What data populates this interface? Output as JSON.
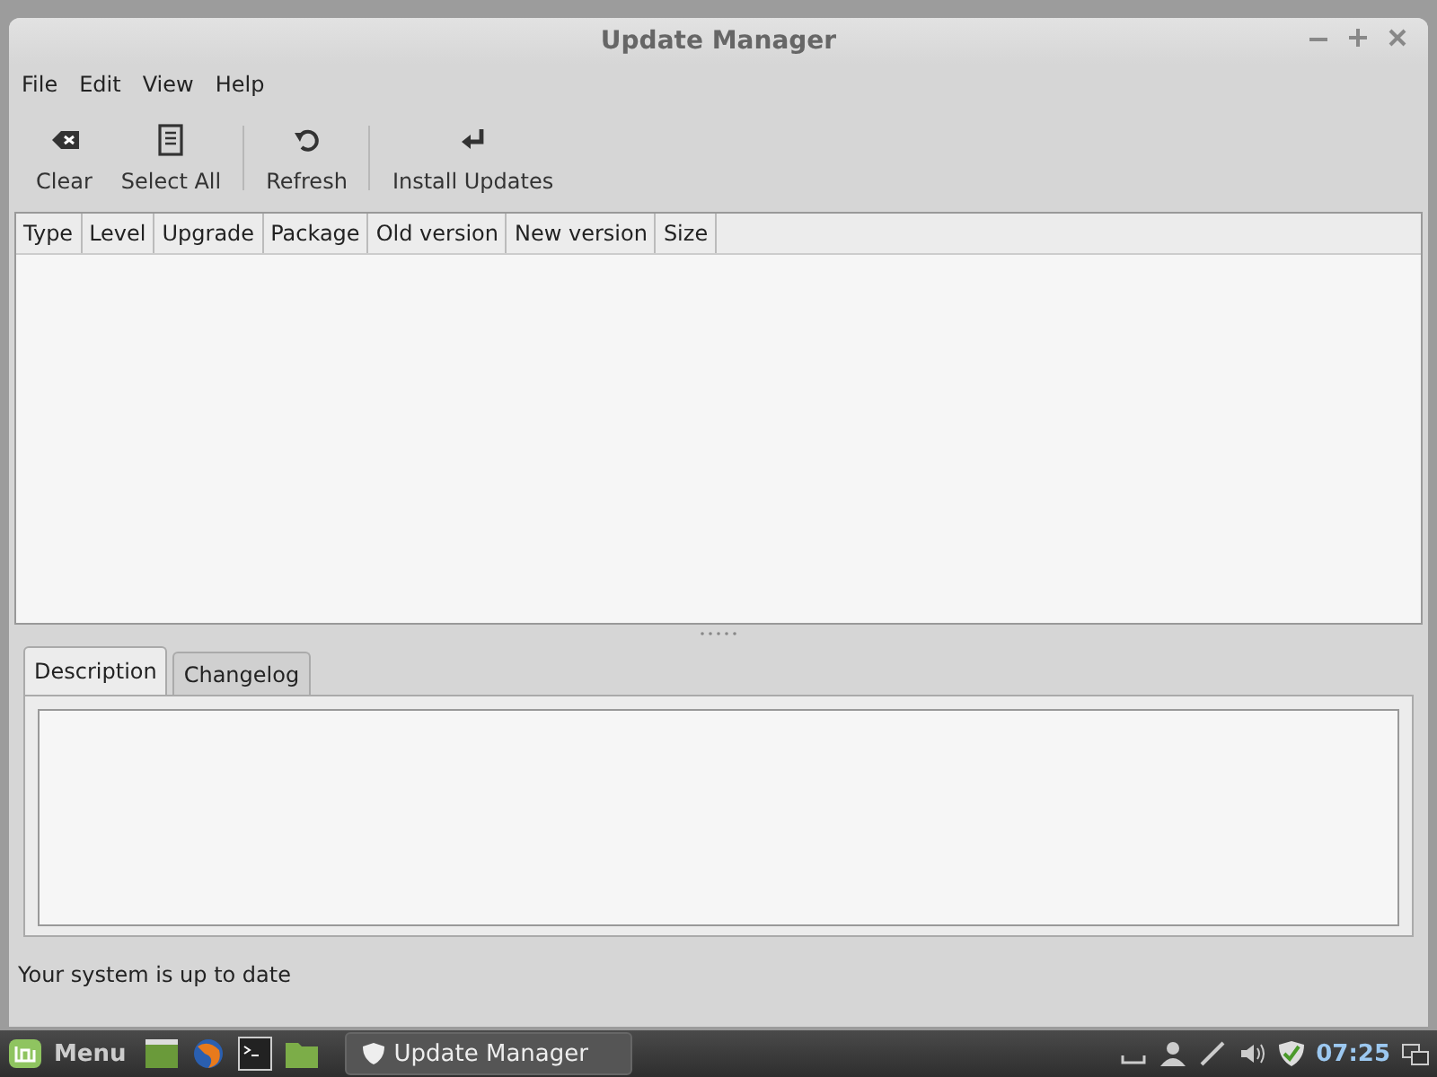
{
  "window": {
    "title": "Update Manager"
  },
  "menu": [
    "File",
    "Edit",
    "View",
    "Help"
  ],
  "toolbar": [
    {
      "label": "Clear",
      "kind": "clear"
    },
    {
      "label": "Select All",
      "kind": "select"
    },
    {
      "label": "Refresh",
      "kind": "refresh"
    },
    {
      "label": "Install Updates",
      "kind": "install"
    }
  ],
  "table": {
    "columns": [
      "Type",
      "Level",
      "Upgrade",
      "Package",
      "Old version",
      "New version",
      "Size"
    ]
  },
  "tabs": [
    {
      "label": "Description",
      "selected": true
    },
    {
      "label": "Changelog",
      "selected": false
    }
  ],
  "status_bar": "Your system is up to date",
  "taskbar": {
    "menu": "Menu",
    "window": "Update Manager",
    "clock": "07:25"
  }
}
